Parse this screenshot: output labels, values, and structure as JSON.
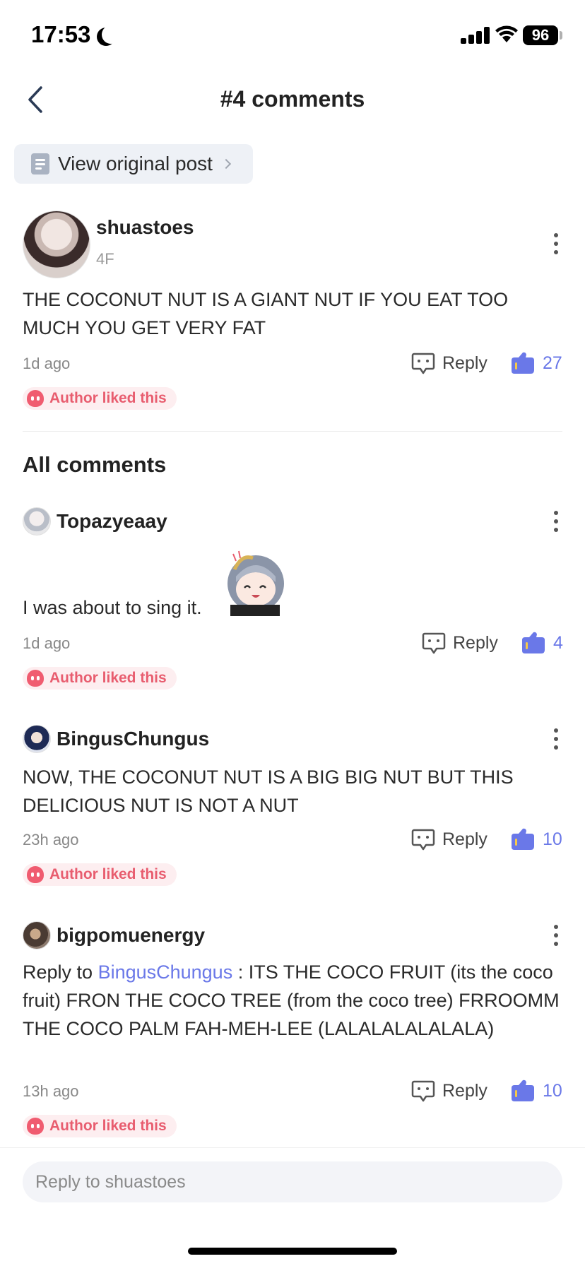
{
  "status_bar": {
    "time": "17:53",
    "battery": "96"
  },
  "header": {
    "title": "#4 comments"
  },
  "view_original": {
    "label": "View original post"
  },
  "main_comment": {
    "username": "shuastoes",
    "floor": "4F",
    "text": "THE COCONUT NUT IS A GIANT NUT IF YOU EAT TOO MUCH YOU GET VERY FAT",
    "time": "1d ago",
    "reply_label": "Reply",
    "likes": "27",
    "badge": "Author liked this"
  },
  "all_comments_title": "All comments",
  "comments": [
    {
      "username": "Topazyeaay",
      "text": "I was about to sing it.",
      "time": "1d ago",
      "reply_label": "Reply",
      "likes": "4",
      "badge": "Author liked this"
    },
    {
      "username": "BingusChungus",
      "text": "NOW, THE COCONUT NUT IS A BIG BIG NUT BUT THIS DELICIOUS NUT IS NOT A NUT",
      "time": "23h ago",
      "reply_label": "Reply",
      "likes": "10",
      "badge": "Author liked this"
    },
    {
      "username": "bigpomuenergy",
      "reply_prefix": "Reply to ",
      "reply_to": "BingusChungus",
      "text": " : ITS THE COCO FRUIT (its the coco fruit) FRON THE COCO TREE (from the coco tree) FRROOMM THE COCO PALM FAH-MEH-LEE (LALALALALALALA)",
      "time": "13h ago",
      "reply_label": "Reply",
      "likes": "10",
      "badge": "Author liked this"
    }
  ],
  "reply_input": {
    "placeholder": "Reply to shuastoes"
  },
  "colors": {
    "accent": "#6a78e8",
    "badge_text": "#e85d6f",
    "badge_bg": "#fdeef0"
  }
}
